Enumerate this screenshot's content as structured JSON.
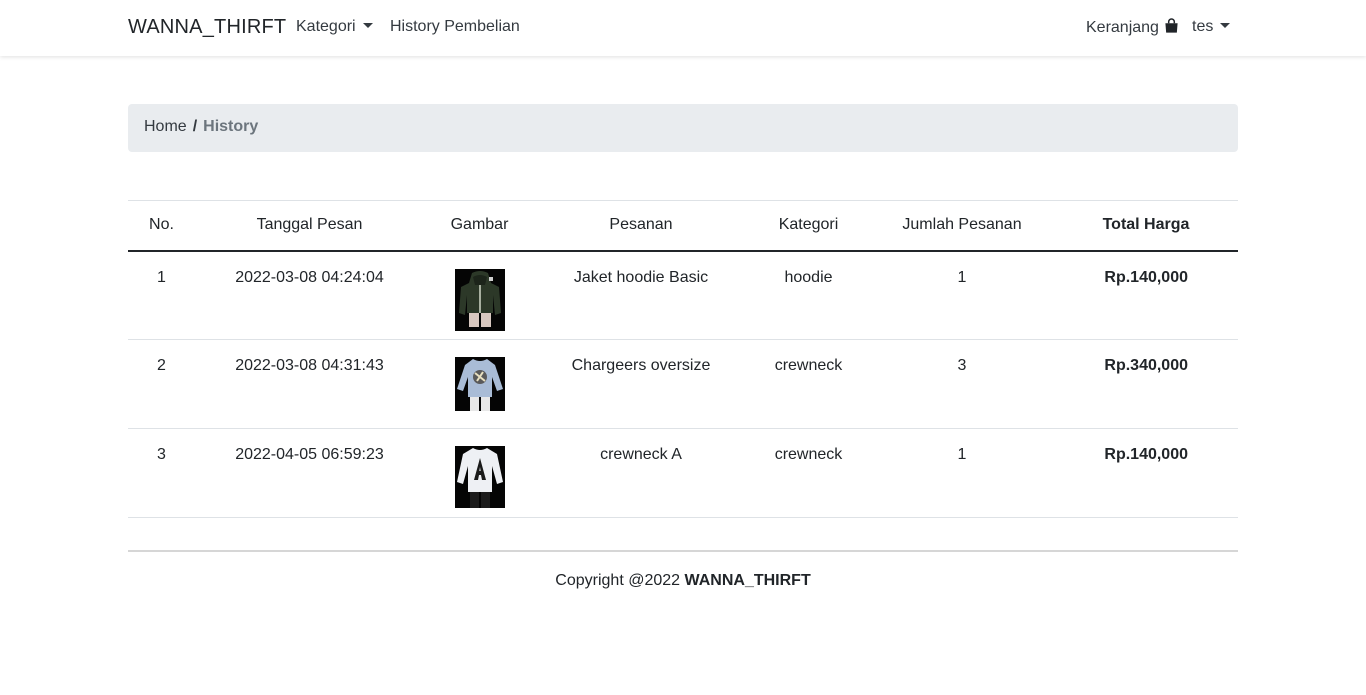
{
  "navbar": {
    "brand": "WANNA_THIRFT",
    "kategori_label": "Kategori",
    "history_label": "History Pembelian",
    "cart_label": "Keranjang",
    "user_label": "tes"
  },
  "breadcrumb": {
    "home": "Home",
    "separator": "/",
    "current": "History"
  },
  "table": {
    "headers": [
      "No.",
      "Tanggal Pesan",
      "Gambar",
      "Pesanan",
      "Kategori",
      "Jumlah Pesanan",
      "Total Harga"
    ],
    "rows": [
      {
        "no": "1",
        "tanggal": "2022-03-08 04:24:04",
        "image_icon": "hoodie-photo",
        "pesanan": "Jaket hoodie Basic",
        "kategori": "hoodie",
        "jumlah": "1",
        "total": "Rp.140,000"
      },
      {
        "no": "2",
        "tanggal": "2022-03-08 04:31:43",
        "image_icon": "crewneck-photo",
        "pesanan": "Chargeers oversize",
        "kategori": "crewneck",
        "jumlah": "3",
        "total": "Rp.340,000"
      },
      {
        "no": "3",
        "tanggal": "2022-04-05 06:59:23",
        "image_icon": "crewneck-a-photo",
        "pesanan": "crewneck A",
        "kategori": "crewneck",
        "jumlah": "1",
        "total": "Rp.140,000"
      }
    ]
  },
  "footer": {
    "copyright": "Copyright @2022",
    "brand": "WANNA_THIRFT"
  },
  "colors": {
    "breadcrumb_bg": "#e9ecef",
    "text": "#212529",
    "muted": "#6c757d"
  }
}
